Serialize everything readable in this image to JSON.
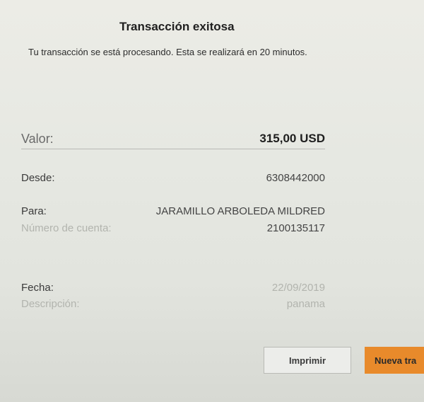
{
  "header": {
    "title": "Transacción exitosa",
    "message": "Tu transacción se está procesando. Esta se realizará en 20 minutos."
  },
  "details": {
    "valor": {
      "label": "Valor:",
      "value": "315,00 USD"
    },
    "desde": {
      "label": "Desde:",
      "value": "6308442000"
    },
    "para": {
      "label": "Para:",
      "value": "JARAMILLO ARBOLEDA MILDRED"
    },
    "cuenta": {
      "label": "Número de cuenta:",
      "value": "2100135117"
    },
    "fecha": {
      "label": "Fecha:",
      "value": "22/09/2019"
    },
    "descripcion": {
      "label": "Descripción:",
      "value": "panama"
    }
  },
  "actions": {
    "print_label": "Imprimir",
    "new_label": "Nueva tra"
  },
  "colors": {
    "accent": "#e88a2b"
  }
}
